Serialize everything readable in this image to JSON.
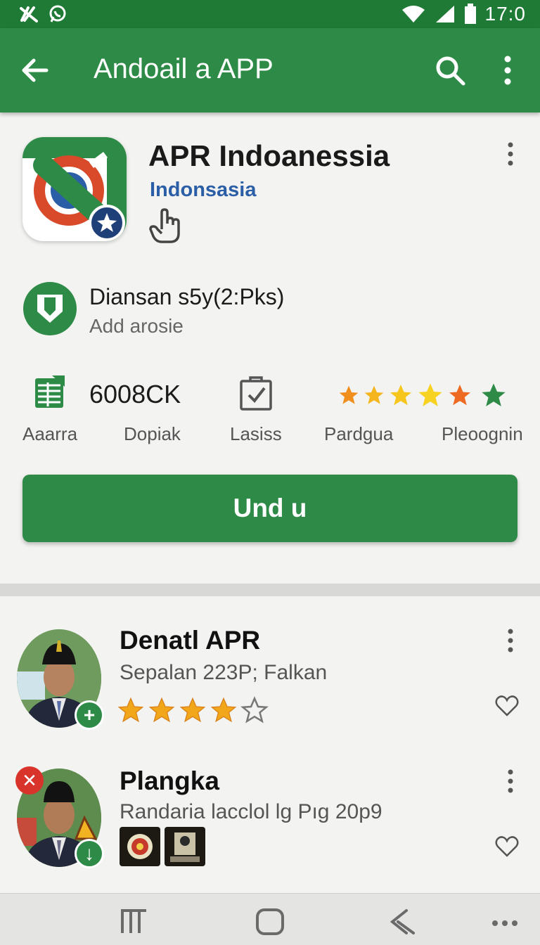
{
  "status_bar": {
    "time": "17:0",
    "icons": [
      "no-signal-icon",
      "whatsapp-icon",
      "wifi-icon",
      "cell-signal-icon",
      "battery-icon"
    ]
  },
  "app_bar": {
    "title": "Andoail a APP",
    "icons": [
      "back-arrow-icon",
      "search-icon",
      "more-vertical-icon"
    ]
  },
  "app": {
    "name": "APR Indoanessia",
    "developer": "Indonsasia",
    "colors": {
      "primary": "#2e8b47",
      "accent_blue": "#2a5ea6",
      "star": "#f2a71b"
    }
  },
  "meta": {
    "title": "Diansan s5y(2:Pks)",
    "subtitle": "Add arosie"
  },
  "stats": {
    "value": "6008CK",
    "labels": [
      "Aaarra",
      "Dopiak",
      "Lasiss",
      "Pardgua",
      "Pleoognin"
    ]
  },
  "install_button": {
    "label": "Und u"
  },
  "list": [
    {
      "title": "Denatl APR",
      "subtitle": "Sepalan 223P; Falkan",
      "rating": 4,
      "rating_max": 5
    },
    {
      "title": "Plangka",
      "subtitle": "Randaria lacclol lg Pıg 20p9"
    }
  ],
  "nav": {
    "icons": [
      "recents-icon",
      "home-icon",
      "back-icon",
      "more-horizontal-icon"
    ]
  }
}
